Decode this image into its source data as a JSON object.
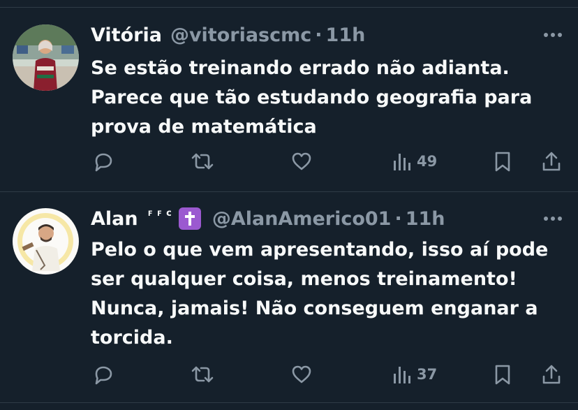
{
  "tweets": [
    {
      "name": "Vitória",
      "handle": "@vitoriascmc",
      "separator": "·",
      "time": "11h",
      "text": "Se estão treinando errado não adianta.\nParece que tão estudando geografia para\nprova de matemática",
      "views": "49",
      "icons": [
        "reply-icon",
        "retweet-icon",
        "like-icon",
        "views-icon",
        "bookmark-icon",
        "share-icon",
        "more-icon"
      ]
    },
    {
      "name": "Alan",
      "name_decoration": "ꜰꜰᴄ",
      "badge_icon": "latin-cross-icon",
      "handle": "@AlanAmerico01",
      "separator": "·",
      "time": "11h",
      "text": "Pelo o que vem apresentando, isso aí pode\nser qualquer coisa, menos treinamento!\nNunca, jamais! Não conseguem enganar a\ntorcida.",
      "views": "37",
      "icons": [
        "reply-icon",
        "retweet-icon",
        "like-icon",
        "views-icon",
        "bookmark-icon",
        "share-icon",
        "more-icon"
      ]
    }
  ],
  "colors": {
    "background": "#15202b",
    "text_primary": "#f7f9f9",
    "text_secondary": "#8b98a5",
    "divider": "#2f3b47",
    "badge": "#9b59d0"
  }
}
